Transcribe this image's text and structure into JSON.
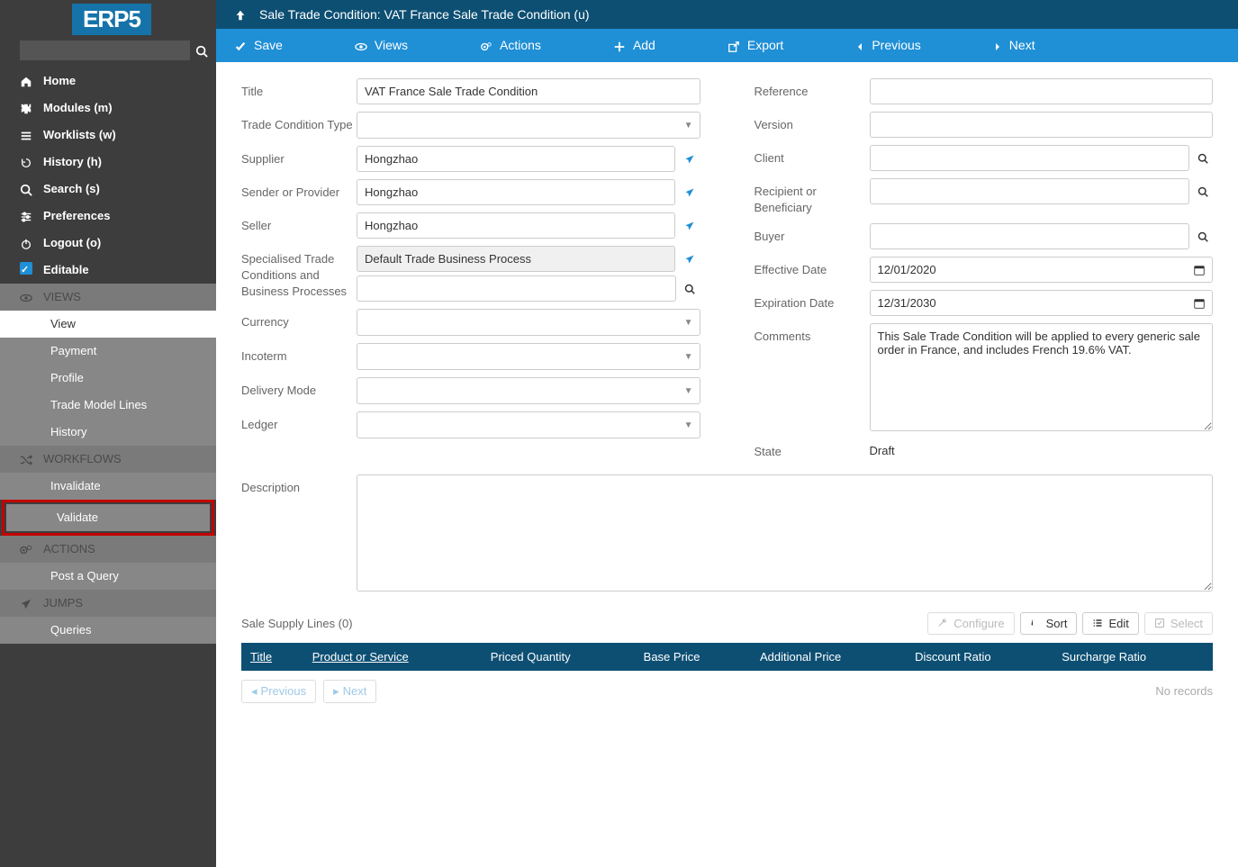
{
  "sidebar": {
    "logo": "ERP5",
    "nav": [
      {
        "icon": "home",
        "label": "Home"
      },
      {
        "icon": "puzzle",
        "label": "Modules (m)"
      },
      {
        "icon": "list",
        "label": "Worklists (w)"
      },
      {
        "icon": "history",
        "label": "History (h)"
      },
      {
        "icon": "search",
        "label": "Search (s)"
      },
      {
        "icon": "sliders",
        "label": "Preferences"
      },
      {
        "icon": "power",
        "label": "Logout (o)"
      },
      {
        "icon": "check",
        "label": "Editable"
      }
    ],
    "views_header": "VIEWS",
    "views": [
      {
        "label": "View",
        "active": true
      },
      {
        "label": "Payment"
      },
      {
        "label": "Profile"
      },
      {
        "label": "Trade Model Lines"
      },
      {
        "label": "History"
      }
    ],
    "workflows_header": "WORKFLOWS",
    "workflows": [
      {
        "label": "Invalidate"
      },
      {
        "label": "Validate",
        "highlight": true
      }
    ],
    "actions_header": "ACTIONS",
    "actions": [
      {
        "label": "Post a Query"
      }
    ],
    "jumps_header": "JUMPS",
    "jumps": [
      {
        "label": "Queries"
      }
    ]
  },
  "header": {
    "title": "Sale Trade Condition: VAT France Sale Trade Condition (u)"
  },
  "actionbar": [
    {
      "icon": "check",
      "label": "Save"
    },
    {
      "icon": "eye",
      "label": "Views"
    },
    {
      "icon": "cogs",
      "label": "Actions"
    },
    {
      "icon": "plus",
      "label": "Add"
    },
    {
      "icon": "export",
      "label": "Export"
    },
    {
      "icon": "prev",
      "label": "Previous"
    },
    {
      "icon": "next",
      "label": "Next"
    }
  ],
  "form": {
    "left": {
      "title_label": "Title",
      "title_value": "VAT France Sale Trade Condition",
      "trade_cond_type_label": "Trade Condition Type",
      "trade_cond_type_value": "",
      "supplier_label": "Supplier",
      "supplier_value": "Hongzhao",
      "sender_label": "Sender or Provider",
      "sender_value": "Hongzhao",
      "seller_label": "Seller",
      "seller_value": "Hongzhao",
      "spec_label": "Specialised Trade Conditions and Business Processes",
      "spec_value": "Default Trade Business Process",
      "currency_label": "Currency",
      "currency_value": "",
      "incoterm_label": "Incoterm",
      "incoterm_value": "",
      "delivery_mode_label": "Delivery Mode",
      "delivery_mode_value": "",
      "ledger_label": "Ledger",
      "ledger_value": ""
    },
    "right": {
      "reference_label": "Reference",
      "reference_value": "",
      "version_label": "Version",
      "version_value": "",
      "client_label": "Client",
      "client_value": "",
      "recipient_label": "Recipient or Beneficiary",
      "recipient_value": "",
      "buyer_label": "Buyer",
      "buyer_value": "",
      "effective_label": "Effective Date",
      "effective_value": "12/01/2020",
      "expiration_label": "Expiration Date",
      "expiration_value": "12/31/2030",
      "comments_label": "Comments",
      "comments_value": "This Sale Trade Condition will be applied to every generic sale order in France, and includes French 19.6% VAT.",
      "state_label": "State",
      "state_value": "Draft"
    },
    "description_label": "Description",
    "description_value": ""
  },
  "supply": {
    "title": "Sale Supply Lines (0)",
    "buttons": {
      "configure": "Configure",
      "sort": "Sort",
      "edit": "Edit",
      "select": "Select"
    },
    "columns": [
      "Title",
      "Product or Service",
      "Priced Quantity",
      "Base Price",
      "Additional Price",
      "Discount Ratio",
      "Surcharge Ratio"
    ],
    "prev": "Previous",
    "next": "Next",
    "empty": "No records"
  }
}
